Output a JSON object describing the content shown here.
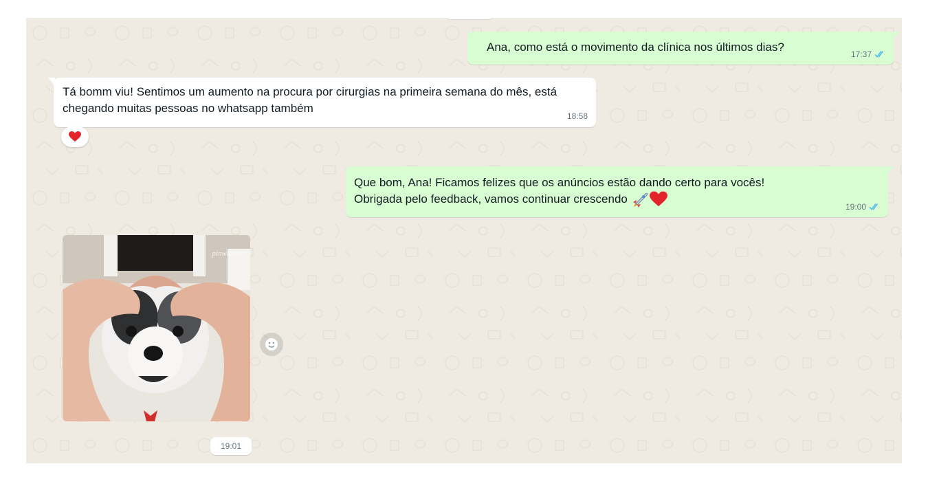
{
  "colors": {
    "chat_background": "#efeae2",
    "outgoing_bubble": "#d9fdd3",
    "incoming_bubble": "#ffffff",
    "read_ticks": "#53bdeb",
    "timestamp": "#667781"
  },
  "messages": [
    {
      "direction": "outgoing",
      "text": "Ana, como está o movimento da clínica nos últimos dias?",
      "time": "17:37",
      "status": "read"
    },
    {
      "direction": "incoming",
      "text": "Tá bomm viu! Sentimos um aumento na procura por cirurgias na primeira semana do mês, está chegando muitas pessoas no whatsapp também",
      "time": "18:58",
      "reaction": "heart-emoji"
    },
    {
      "direction": "outgoing",
      "text_line1": "Que bom, Ana! Ficamos felizes que os anúncios estão dando certo para vocês!",
      "text_line2": "Obrigada pelo feedback, vamos continuar crescendo",
      "emojis": [
        "rocket-emoji",
        "heart-emoji"
      ],
      "time": "19:00",
      "status": "read"
    },
    {
      "direction": "incoming",
      "type": "image",
      "image_watermark": "pinwlctive",
      "time": "19:01"
    }
  ],
  "icons": {
    "read_status": "double-check-icon",
    "react": "smiley-icon"
  }
}
